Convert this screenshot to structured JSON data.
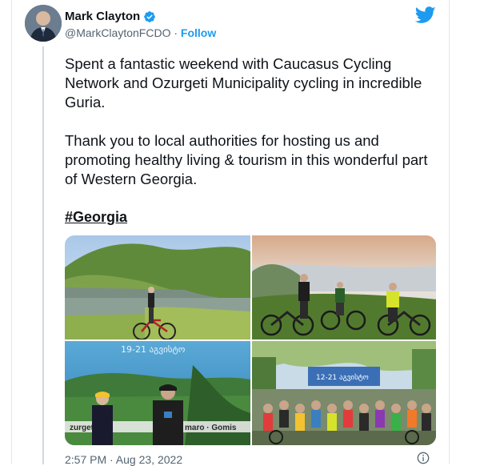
{
  "author": {
    "name": "Mark Clayton",
    "handle": "@MarkClaytonFCDO",
    "separator": "·",
    "follow_label": "Follow"
  },
  "tweet": {
    "paragraph1": "Spent a fantastic weekend with Caucasus Cycling Network and Ozurgeti Municipality cycling in incredible Guria.",
    "paragraph2": "Thank you to local authorities for hosting us and promoting healthy living & tourism in this wonderful part of Western Georgia.",
    "hashtag": "#Georgia"
  },
  "media": {
    "photos": [
      {
        "name": "lake-cyclist-photo"
      },
      {
        "name": "mountain-cyclists-photo"
      },
      {
        "name": "banner-group-photo"
      },
      {
        "name": "large-group-photo",
        "banner_text": "12-21 აგვისტო"
      }
    ],
    "photo3_banner_left": "zurgeti",
    "photo3_banner_right": "maro · Gomis"
  },
  "timestamp": "2:57 PM · Aug 23, 2022",
  "colors": {
    "accent": "#1d9bf0",
    "text": "#0f1419",
    "secondary": "#536471"
  },
  "icons": {
    "verified": "verified-badge-icon",
    "brand": "twitter-bird-icon",
    "info": "info-icon"
  }
}
